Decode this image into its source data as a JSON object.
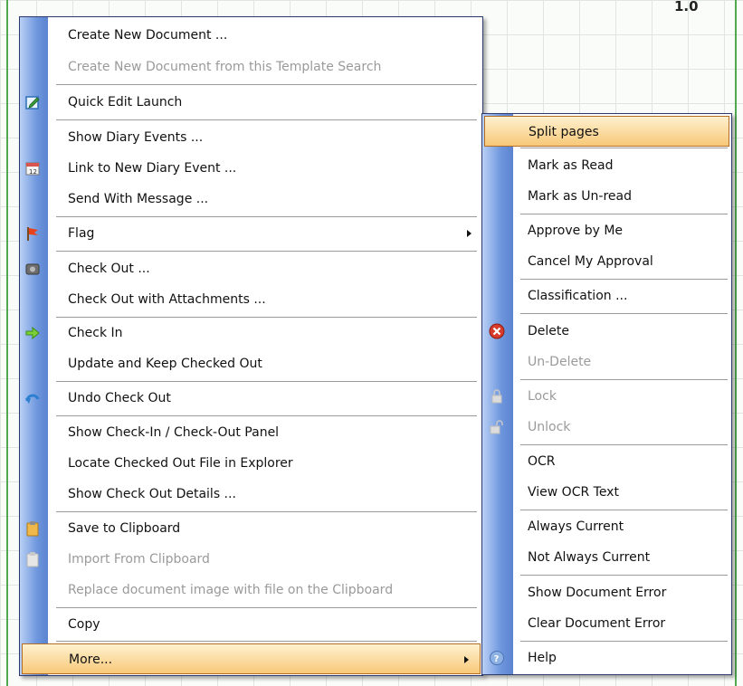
{
  "background": {
    "corner_value": "1.0"
  },
  "main_menu": {
    "items": [
      {
        "label": "Create New Document ...",
        "icon": null,
        "disabled": false
      },
      {
        "label": "Create New Document from this Template Search",
        "icon": null,
        "disabled": true
      },
      {
        "label": "Quick Edit Launch",
        "icon": "quick-edit-icon",
        "disabled": false
      },
      {
        "label": "Show Diary Events ...",
        "icon": null,
        "disabled": false
      },
      {
        "label": "Link to New Diary Event ...",
        "icon": "calendar-icon",
        "disabled": false
      },
      {
        "label": "Send With Message ...",
        "icon": null,
        "disabled": false
      },
      {
        "label": "Flag",
        "icon": "flag-icon",
        "disabled": false,
        "submenu": true
      },
      {
        "label": "Check Out ...",
        "icon": "check-out-icon",
        "disabled": false
      },
      {
        "label": "Check Out with Attachments ...",
        "icon": null,
        "disabled": false
      },
      {
        "label": "Check In",
        "icon": "check-in-arrow-icon",
        "disabled": false
      },
      {
        "label": "Update and Keep Checked Out",
        "icon": null,
        "disabled": false
      },
      {
        "label": "Undo Check Out",
        "icon": "undo-icon",
        "disabled": false
      },
      {
        "label": "Show Check-In / Check-Out Panel",
        "icon": null,
        "disabled": false
      },
      {
        "label": "Locate Checked Out File in Explorer",
        "icon": null,
        "disabled": false
      },
      {
        "label": "Show Check Out Details ...",
        "icon": null,
        "disabled": false
      },
      {
        "label": "Save to Clipboard",
        "icon": "clipboard-icon",
        "disabled": false
      },
      {
        "label": "Import From Clipboard",
        "icon": "clipboard-import-icon",
        "disabled": true
      },
      {
        "label": "Replace document image with file on the Clipboard",
        "icon": null,
        "disabled": true
      },
      {
        "label": "Copy",
        "icon": null,
        "disabled": false
      },
      {
        "label": "More...",
        "icon": null,
        "disabled": false,
        "submenu": true,
        "highlighted": true
      }
    ]
  },
  "sub_menu": {
    "items": [
      {
        "label": "Split pages",
        "icon": null,
        "disabled": false,
        "highlighted": true
      },
      {
        "label": "Mark as Read",
        "icon": null,
        "disabled": false
      },
      {
        "label": "Mark as Un-read",
        "icon": null,
        "disabled": false
      },
      {
        "label": "Approve by Me",
        "icon": null,
        "disabled": false
      },
      {
        "label": "Cancel My Approval",
        "icon": null,
        "disabled": false
      },
      {
        "label": "Classification ...",
        "icon": null,
        "disabled": false
      },
      {
        "label": "Delete",
        "icon": "delete-icon",
        "disabled": false
      },
      {
        "label": "Un-Delete",
        "icon": null,
        "disabled": true
      },
      {
        "label": "Lock",
        "icon": "lock-icon",
        "disabled": true
      },
      {
        "label": "Unlock",
        "icon": "unlock-icon",
        "disabled": true
      },
      {
        "label": "OCR",
        "icon": null,
        "disabled": false
      },
      {
        "label": "View OCR Text",
        "icon": null,
        "disabled": false
      },
      {
        "label": "Always Current",
        "icon": null,
        "disabled": false
      },
      {
        "label": "Not Always Current",
        "icon": null,
        "disabled": false
      },
      {
        "label": "Show Document Error",
        "icon": null,
        "disabled": false
      },
      {
        "label": "Clear Document Error",
        "icon": null,
        "disabled": false
      },
      {
        "label": "Help",
        "icon": "help-icon",
        "disabled": false
      }
    ]
  },
  "colors": {
    "highlight": "#f7c878",
    "highlight_border": "#b36d24",
    "gutter": "#6f97de",
    "disabled_text": "#9a9a9a",
    "frame": "#4fa84f"
  }
}
